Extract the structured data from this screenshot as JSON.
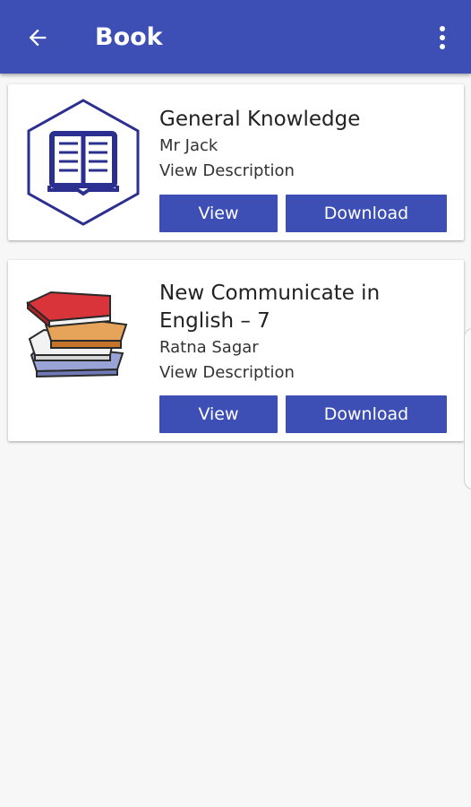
{
  "appbar": {
    "title": "Book",
    "background_color": "#3d4fb5",
    "back_icon": "arrow-left-icon",
    "menu_icon": "more-vertical-icon"
  },
  "books": [
    {
      "title": "General Knowledge",
      "author": "Mr Jack",
      "description_link": "View Description",
      "view_label": "View",
      "download_label": "Download",
      "thumbnail": "hexagon-open-book-icon"
    },
    {
      "title": "New Communicate in English – 7",
      "author": "Ratna Sagar",
      "description_link": "View Description",
      "view_label": "View",
      "download_label": "Download",
      "thumbnail": "stack-of-books-icon"
    }
  ],
  "accent_color": "#3d4fb5"
}
